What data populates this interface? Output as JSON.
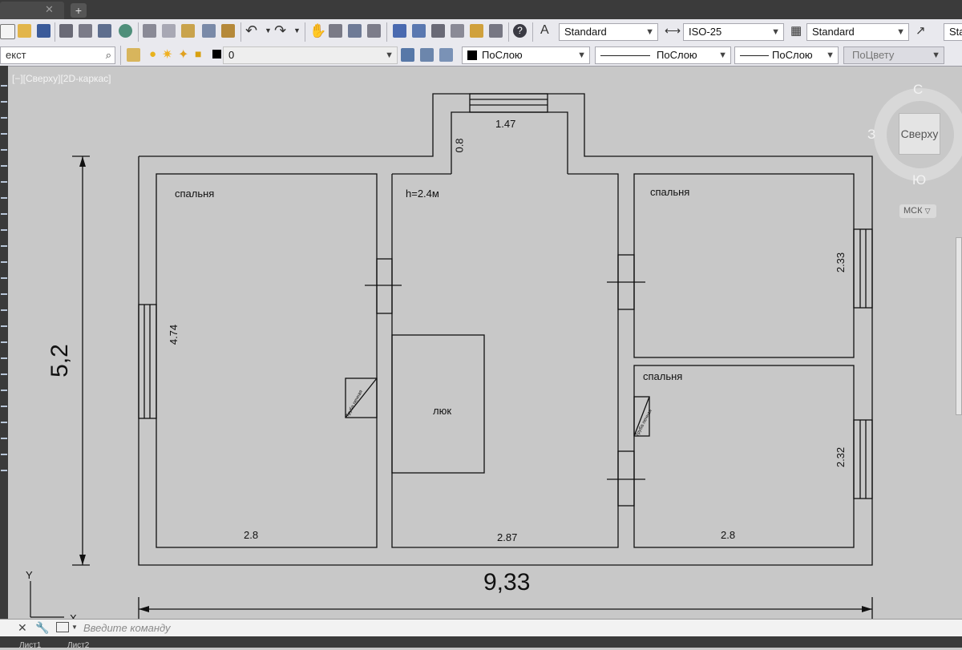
{
  "toolbar": {
    "text_style": "Standard",
    "dim_style": "ISO-25",
    "table_style": "Standard",
    "multileader_style": "Sta",
    "search_text": "екст",
    "layer_name": "0",
    "color": "ПоСлою",
    "linetype": "ПоСлою",
    "lineweight": "ПоСлою",
    "plotstyle": "ПоЦвету"
  },
  "viewport": {
    "label": "[−][Сверху][2D-каркас]"
  },
  "viewcube": {
    "face": "Сверху",
    "north": "С",
    "south": "Ю",
    "west": "З",
    "ucs": "МСК"
  },
  "plan": {
    "room_left": "спальня",
    "room_right_top": "спальня",
    "room_right_bottom": "спальня",
    "center_height": "h=2.4м",
    "hatch": "люк",
    "stove_left": "Труба печная",
    "stove_right": "Труба печная",
    "dims": {
      "porch_width": "1.47",
      "porch_depth": "0.8",
      "left_height": "4.74",
      "left_width": "2.8",
      "center_width": "2.87",
      "right_width": "2.8",
      "right_top_height": "2.33",
      "right_bottom_height": "2.32",
      "overall_height": "5,2",
      "overall_width": "9,33"
    }
  },
  "ucs_icon": {
    "y": "Y",
    "x": "X"
  },
  "command": {
    "placeholder": "Введите команду"
  },
  "status": {
    "tab1": "Лист1",
    "tab2": "Лист2"
  }
}
